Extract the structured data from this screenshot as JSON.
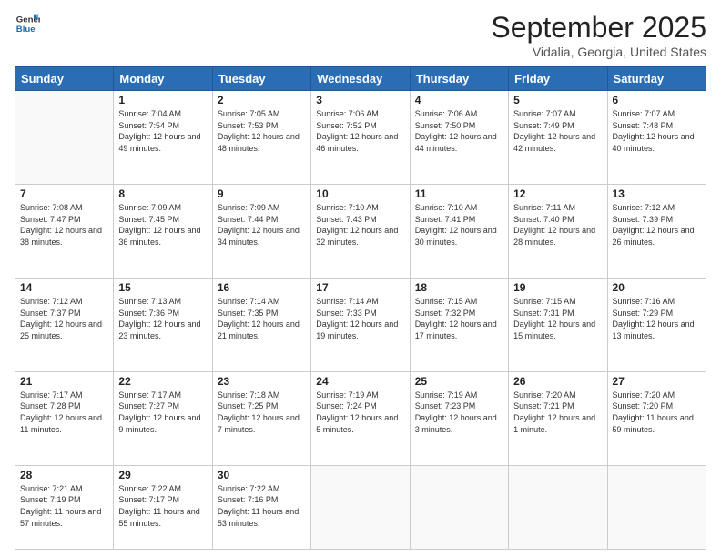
{
  "header": {
    "logo": {
      "line1": "General",
      "line2": "Blue"
    },
    "title": "September 2025",
    "location": "Vidalia, Georgia, United States"
  },
  "weekdays": [
    "Sunday",
    "Monday",
    "Tuesday",
    "Wednesday",
    "Thursday",
    "Friday",
    "Saturday"
  ],
  "weeks": [
    [
      null,
      {
        "num": "1",
        "sunrise": "7:04 AM",
        "sunset": "7:54 PM",
        "daylight": "12 hours and 49 minutes."
      },
      {
        "num": "2",
        "sunrise": "7:05 AM",
        "sunset": "7:53 PM",
        "daylight": "12 hours and 48 minutes."
      },
      {
        "num": "3",
        "sunrise": "7:06 AM",
        "sunset": "7:52 PM",
        "daylight": "12 hours and 46 minutes."
      },
      {
        "num": "4",
        "sunrise": "7:06 AM",
        "sunset": "7:50 PM",
        "daylight": "12 hours and 44 minutes."
      },
      {
        "num": "5",
        "sunrise": "7:07 AM",
        "sunset": "7:49 PM",
        "daylight": "12 hours and 42 minutes."
      },
      {
        "num": "6",
        "sunrise": "7:07 AM",
        "sunset": "7:48 PM",
        "daylight": "12 hours and 40 minutes."
      }
    ],
    [
      {
        "num": "7",
        "sunrise": "7:08 AM",
        "sunset": "7:47 PM",
        "daylight": "12 hours and 38 minutes."
      },
      {
        "num": "8",
        "sunrise": "7:09 AM",
        "sunset": "7:45 PM",
        "daylight": "12 hours and 36 minutes."
      },
      {
        "num": "9",
        "sunrise": "7:09 AM",
        "sunset": "7:44 PM",
        "daylight": "12 hours and 34 minutes."
      },
      {
        "num": "10",
        "sunrise": "7:10 AM",
        "sunset": "7:43 PM",
        "daylight": "12 hours and 32 minutes."
      },
      {
        "num": "11",
        "sunrise": "7:10 AM",
        "sunset": "7:41 PM",
        "daylight": "12 hours and 30 minutes."
      },
      {
        "num": "12",
        "sunrise": "7:11 AM",
        "sunset": "7:40 PM",
        "daylight": "12 hours and 28 minutes."
      },
      {
        "num": "13",
        "sunrise": "7:12 AM",
        "sunset": "7:39 PM",
        "daylight": "12 hours and 26 minutes."
      }
    ],
    [
      {
        "num": "14",
        "sunrise": "7:12 AM",
        "sunset": "7:37 PM",
        "daylight": "12 hours and 25 minutes."
      },
      {
        "num": "15",
        "sunrise": "7:13 AM",
        "sunset": "7:36 PM",
        "daylight": "12 hours and 23 minutes."
      },
      {
        "num": "16",
        "sunrise": "7:14 AM",
        "sunset": "7:35 PM",
        "daylight": "12 hours and 21 minutes."
      },
      {
        "num": "17",
        "sunrise": "7:14 AM",
        "sunset": "7:33 PM",
        "daylight": "12 hours and 19 minutes."
      },
      {
        "num": "18",
        "sunrise": "7:15 AM",
        "sunset": "7:32 PM",
        "daylight": "12 hours and 17 minutes."
      },
      {
        "num": "19",
        "sunrise": "7:15 AM",
        "sunset": "7:31 PM",
        "daylight": "12 hours and 15 minutes."
      },
      {
        "num": "20",
        "sunrise": "7:16 AM",
        "sunset": "7:29 PM",
        "daylight": "12 hours and 13 minutes."
      }
    ],
    [
      {
        "num": "21",
        "sunrise": "7:17 AM",
        "sunset": "7:28 PM",
        "daylight": "12 hours and 11 minutes."
      },
      {
        "num": "22",
        "sunrise": "7:17 AM",
        "sunset": "7:27 PM",
        "daylight": "12 hours and 9 minutes."
      },
      {
        "num": "23",
        "sunrise": "7:18 AM",
        "sunset": "7:25 PM",
        "daylight": "12 hours and 7 minutes."
      },
      {
        "num": "24",
        "sunrise": "7:19 AM",
        "sunset": "7:24 PM",
        "daylight": "12 hours and 5 minutes."
      },
      {
        "num": "25",
        "sunrise": "7:19 AM",
        "sunset": "7:23 PM",
        "daylight": "12 hours and 3 minutes."
      },
      {
        "num": "26",
        "sunrise": "7:20 AM",
        "sunset": "7:21 PM",
        "daylight": "12 hours and 1 minute."
      },
      {
        "num": "27",
        "sunrise": "7:20 AM",
        "sunset": "7:20 PM",
        "daylight": "11 hours and 59 minutes."
      }
    ],
    [
      {
        "num": "28",
        "sunrise": "7:21 AM",
        "sunset": "7:19 PM",
        "daylight": "11 hours and 57 minutes."
      },
      {
        "num": "29",
        "sunrise": "7:22 AM",
        "sunset": "7:17 PM",
        "daylight": "11 hours and 55 minutes."
      },
      {
        "num": "30",
        "sunrise": "7:22 AM",
        "sunset": "7:16 PM",
        "daylight": "11 hours and 53 minutes."
      },
      null,
      null,
      null,
      null
    ]
  ]
}
